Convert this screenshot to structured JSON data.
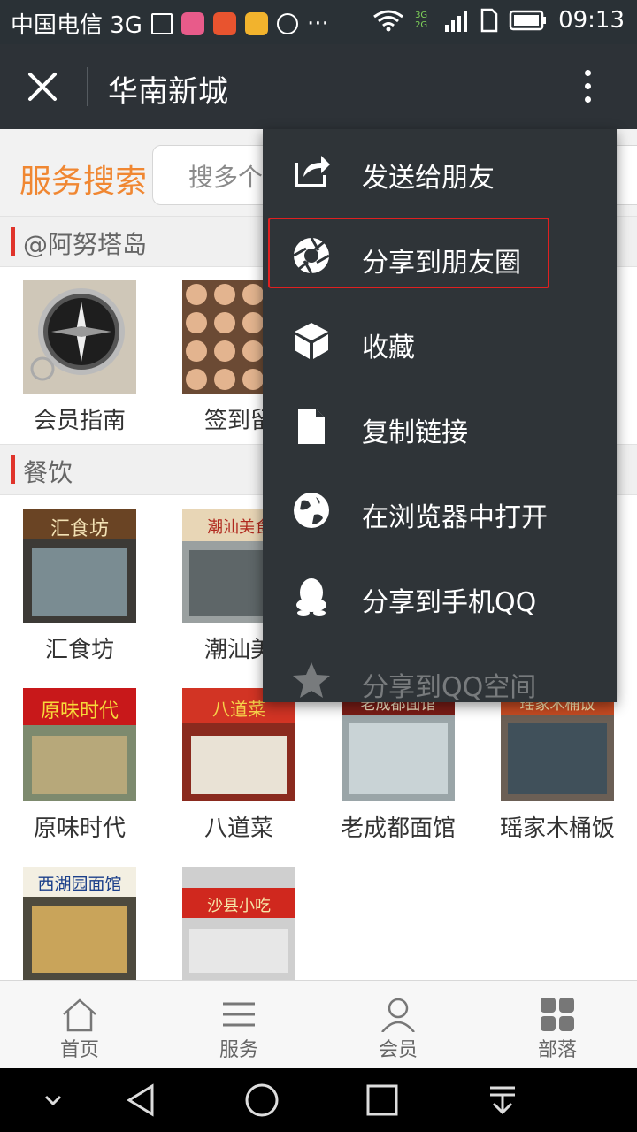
{
  "status_bar": {
    "carrier": "中国电信 3G",
    "more": "···",
    "time": "09:13",
    "network_badge": "3G 2G"
  },
  "header": {
    "title": "华南新城"
  },
  "search": {
    "label": "服务搜索",
    "placeholder": "搜多个"
  },
  "sections": [
    {
      "title": "@阿努塔岛",
      "items": [
        {
          "caption": "会员指南",
          "icon": "compass-image"
        },
        {
          "caption": "签到留",
          "icon": "faces-collage-image"
        }
      ]
    },
    {
      "title": "餐饮",
      "items": [
        {
          "caption": "汇食坊",
          "sign": "汇食坊"
        },
        {
          "caption": "潮汕美",
          "sign": "潮汕美食"
        },
        {
          "caption": "原味时代",
          "sign": "原味时代"
        },
        {
          "caption": "八道菜",
          "sign": "八道菜"
        },
        {
          "caption": "老成都面馆",
          "sign": "老成都面馆"
        },
        {
          "caption": "瑶家木桶饭",
          "sign": "瑶家木桶饭"
        },
        {
          "caption": "",
          "sign": "西湖园面馆"
        },
        {
          "caption": "",
          "sign": "沙县小吃"
        }
      ]
    }
  ],
  "menu": {
    "items": [
      {
        "label": "发送给朋友",
        "icon": "share-icon"
      },
      {
        "label": "分享到朋友圈",
        "icon": "aperture-icon",
        "highlighted": true
      },
      {
        "label": "收藏",
        "icon": "cube-icon"
      },
      {
        "label": "复制链接",
        "icon": "copy-icon"
      },
      {
        "label": "在浏览器中打开",
        "icon": "globe-icon"
      },
      {
        "label": "分享到手机QQ",
        "icon": "qq-icon"
      },
      {
        "label": "分享到QQ空间",
        "icon": "star-icon"
      }
    ]
  },
  "tabbar": {
    "items": [
      {
        "label": "首页",
        "icon": "home-icon"
      },
      {
        "label": "服务",
        "icon": "list-icon"
      },
      {
        "label": "会员",
        "icon": "person-icon"
      },
      {
        "label": "部落",
        "icon": "grid-icon"
      }
    ]
  },
  "colors": {
    "accent_orange": "#f08732",
    "section_bar_red": "#e0342b",
    "highlight_red": "#e02020",
    "dark_bar": "#2d3237"
  }
}
